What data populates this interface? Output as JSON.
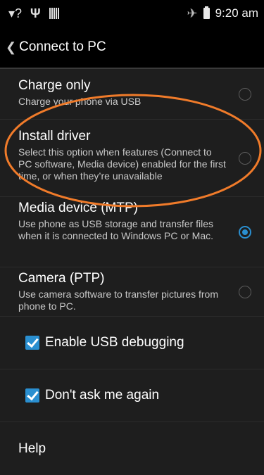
{
  "status_bar": {
    "icons": [
      "wifi-question-icon",
      "usb-icon",
      "barcode-icon",
      "airplane-mode-icon",
      "battery-icon"
    ],
    "clock": "9:20 am"
  },
  "action_bar": {
    "back_icon": "chevron-left-icon",
    "title": "Connect to PC"
  },
  "options": [
    {
      "title": "Charge only",
      "desc": "Charge your phone via USB",
      "selected": false
    },
    {
      "title": "Install driver",
      "desc": "Select this option when features (Connect to PC software, Media device) enabled for the first time, or when they’re unavailable",
      "selected": false
    },
    {
      "title": "Media device (MTP)",
      "desc": "Use phone as USB storage and transfer files when it is connected to Windows PC or Mac.",
      "selected": true
    },
    {
      "title": "Camera (PTP)",
      "desc": "Use camera software to transfer pictures from phone to PC.",
      "selected": false
    }
  ],
  "checkboxes": [
    {
      "label": "Enable USB debugging",
      "checked": true
    },
    {
      "label": "Don't ask me again",
      "checked": true
    }
  ],
  "help": {
    "label": "Help"
  },
  "colors": {
    "accent": "#2a8fd0",
    "annotation": "#f07b2a",
    "background": "#1e1e1e"
  }
}
